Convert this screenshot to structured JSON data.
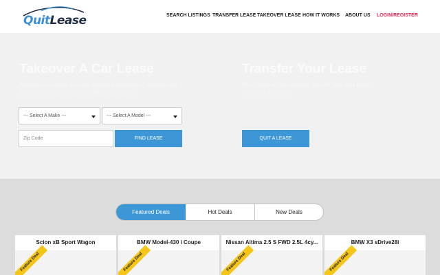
{
  "header": {
    "logo": {
      "part1": "Quit",
      "part2": "Lease"
    },
    "nav": [
      {
        "label": "SEARCH LISTINGS"
      },
      {
        "label": "TRANSFER LEASE"
      },
      {
        "label": "TAKEOVER LEASE"
      },
      {
        "label": "HOW IT WORKS"
      },
      {
        "label": "ABOUT US"
      },
      {
        "label": "LOGIN/REGISTER"
      }
    ]
  },
  "hero": {
    "takeover": {
      "title": "Takeover A Car Lease",
      "subtitle": "Assume a car lease from our extensive database of vehicles and find the best deal without any additional hassle.",
      "make_select": "--- Select A Make ---",
      "model_select": "--- Select A Model ---",
      "zip_placeholder": "Zip Code",
      "find_button": "FIND LEASE"
    },
    "transfer": {
      "title": "Transfer Your Lease",
      "subtitle": "Don't move on the calendar, transfer your auto lease whenever you need!",
      "quit_button": "QUIT A LEASE"
    }
  },
  "deals": {
    "tabs": [
      {
        "label": "Featured Deals"
      },
      {
        "label": "Hot Deals"
      },
      {
        "label": "New Deals"
      }
    ],
    "cards": [
      {
        "title": "Scion xB Sport Wagon",
        "ribbon": "Feature Deal"
      },
      {
        "title": "BMW Model-430 i Coupe",
        "ribbon": "Feature Deal"
      },
      {
        "title": "Nissan Altima 2.5 S FWD 2.5L 4cy...",
        "ribbon": "Feature Deal"
      },
      {
        "title": "BMW X3 sDrive28i",
        "ribbon": "Feature Deal"
      }
    ]
  }
}
